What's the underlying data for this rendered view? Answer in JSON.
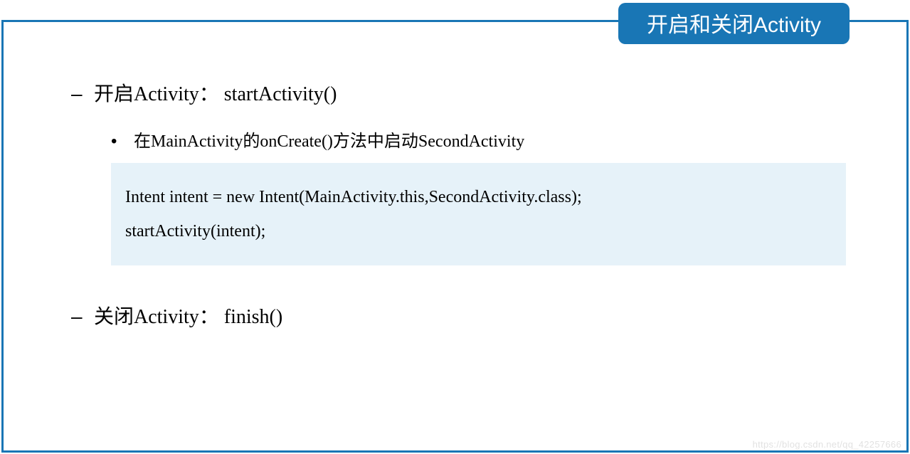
{
  "title": "开启和关闭Activity",
  "section1": {
    "heading": "开启Activity： startActivity()",
    "subheading": "在MainActivity的onCreate()方法中启动SecondActivity",
    "code_line1": "Intent intent = new Intent(MainActivity.this,SecondActivity.class);",
    "code_line2": "startActivity(intent);"
  },
  "section2": {
    "heading": "关闭Activity： finish()"
  },
  "watermark": "https://blog.csdn.net/qq_42257666"
}
